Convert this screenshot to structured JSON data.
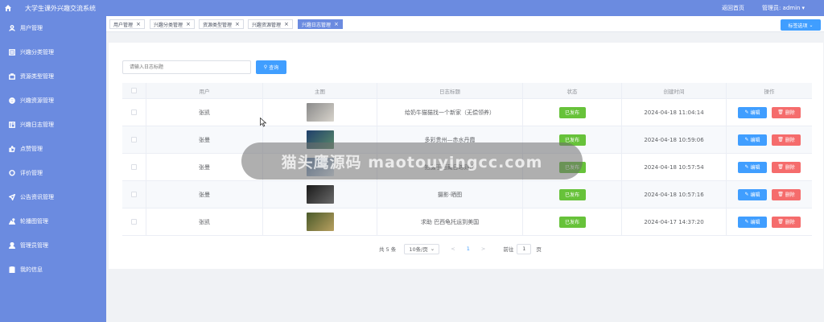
{
  "app": {
    "title": "大学生课外兴趣交流系统",
    "back_home": "返回首页",
    "admin_label": "管理员: admin"
  },
  "sidebar": {
    "items": [
      {
        "label": "用户管理",
        "icon": "user-icon"
      },
      {
        "label": "兴趣分类管理",
        "icon": "list-icon"
      },
      {
        "label": "资源类型管理",
        "icon": "briefcase-icon"
      },
      {
        "label": "兴趣资源管理",
        "icon": "globe-icon"
      },
      {
        "label": "兴趣日志管理",
        "icon": "log-icon"
      },
      {
        "label": "点赞管理",
        "icon": "like-icon"
      },
      {
        "label": "评价管理",
        "icon": "comment-icon"
      },
      {
        "label": "公告资讯管理",
        "icon": "send-icon"
      },
      {
        "label": "轮播图管理",
        "icon": "image-icon"
      },
      {
        "label": "管理员管理",
        "icon": "admin-icon"
      },
      {
        "label": "我的信息",
        "icon": "clipboard-icon"
      }
    ]
  },
  "tags": {
    "items": [
      "用户管理",
      "兴趣分类管理",
      "资源类型管理",
      "兴趣资源管理",
      "兴趣日志管理"
    ],
    "options": "标签选项",
    "close": "×"
  },
  "search": {
    "placeholder": "请输入日志标题",
    "button": "查询"
  },
  "table": {
    "headers": [
      "用户",
      "主图",
      "日志标题",
      "状态",
      "创建时间",
      "操作"
    ],
    "rows": [
      {
        "user": "张凯",
        "title": "给奶牛猫猫找一个新家（无偿领养）",
        "status": "已发布",
        "created": "2024-04-18 11:04:14",
        "thumb_colors": [
          "#8a8a8a",
          "#d8d4cc"
        ]
      },
      {
        "user": "张曼",
        "title": "多彩贵州—赤水丹霞",
        "status": "已发布",
        "created": "2024-04-18 10:59:06",
        "thumb_colors": [
          "#1f3f6b",
          "#5b8b6a"
        ]
      },
      {
        "user": "张曼",
        "title": "拍摄于西藏日喀则市",
        "status": "已发布",
        "created": "2024-04-18 10:57:54",
        "thumb_colors": [
          "#5e7fa8",
          "#dce6f0"
        ]
      },
      {
        "user": "张曼",
        "title": "摄影·晒图",
        "status": "已发布",
        "created": "2024-04-18 10:57:16",
        "thumb_colors": [
          "#1a1a1a",
          "#6a6a6a"
        ]
      },
      {
        "user": "张凯",
        "title": "求助 巴西龟托运到美国",
        "status": "已发布",
        "created": "2024-04-17 14:37:20",
        "thumb_colors": [
          "#4a5a2a",
          "#b8a060"
        ]
      }
    ],
    "edit_label": "编辑",
    "delete_label": "删除"
  },
  "pagination": {
    "total": "共 5 条",
    "page_size": "10条/页",
    "prev": "<",
    "current": "1",
    "next": ">",
    "goto": "前往",
    "goto_value": "1",
    "page_suffix": "页"
  },
  "watermark": {
    "text": "猫头鹰源码 maotouyingcc.com"
  },
  "colors": {
    "sidebar": "#6b8be0",
    "primary": "#409eff",
    "success": "#67c23a",
    "danger": "#f56c6c"
  }
}
